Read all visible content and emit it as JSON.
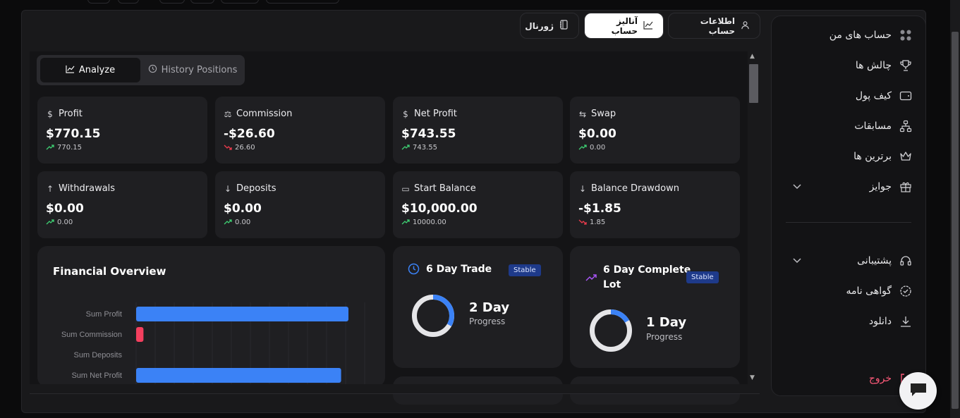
{
  "sidebar": {
    "items": [
      {
        "label": "حساب های من",
        "icon": "grid-icon"
      },
      {
        "label": "چالش ها",
        "icon": "trophy-icon"
      },
      {
        "label": "کیف پول",
        "icon": "wallet-icon"
      },
      {
        "label": "مسابقات",
        "icon": "network-icon"
      },
      {
        "label": "برترین ها",
        "icon": "crown-icon"
      },
      {
        "label": "جوایز",
        "icon": "gift-icon"
      },
      {
        "label": "پشتیبانی",
        "icon": "headset-icon"
      },
      {
        "label": "گواهی نامه",
        "icon": "certificate-icon"
      },
      {
        "label": "دانلود",
        "icon": "download-icon"
      }
    ],
    "logout": "خروج"
  },
  "top_tabs": [
    {
      "label": "اطلاعات حساب",
      "icon": "user-icon"
    },
    {
      "label": "آنالیز حساب",
      "icon": "chart-icon"
    },
    {
      "label": "ژورنال",
      "icon": "journal-icon"
    }
  ],
  "sub_tabs": {
    "analyze": "Analyze",
    "history": "History Positions"
  },
  "cards": [
    {
      "label": "Profit",
      "value": "$770.15",
      "sub": "770.15",
      "trend": "up",
      "icon": "dollar-icon"
    },
    {
      "label": "Commission",
      "value": "-$26.60",
      "sub": "26.60",
      "trend": "down",
      "icon": "scale-icon"
    },
    {
      "label": "Net Profit",
      "value": "$743.55",
      "sub": "743.55",
      "trend": "up",
      "icon": "dollar-icon"
    },
    {
      "label": "Swap",
      "value": "$0.00",
      "sub": "0.00",
      "trend": "up",
      "icon": "swap-icon"
    },
    {
      "label": "Withdrawals",
      "value": "$0.00",
      "sub": "0.00",
      "trend": "up",
      "icon": "arrow-up-icon"
    },
    {
      "label": "Deposits",
      "value": "$0.00",
      "sub": "0.00",
      "trend": "up",
      "icon": "arrow-down-icon"
    },
    {
      "label": "Start Balance",
      "value": "$10,000.00",
      "sub": "10000.00",
      "trend": "up",
      "icon": "wallet-icon"
    },
    {
      "label": "Balance Drawdown",
      "value": "-$1.85",
      "sub": "1.85",
      "trend": "down",
      "icon": "arrow-down-icon"
    }
  ],
  "financial_overview": {
    "title": "Financial Overview"
  },
  "chart_data": {
    "type": "bar",
    "orientation": "horizontal",
    "categories": [
      "Sum Profit",
      "Sum Commission",
      "Sum Deposits",
      "Sum Net Profit"
    ],
    "values": [
      770.15,
      26.6,
      0,
      743.55
    ],
    "colors": [
      "#3b82f6",
      "#f43f5e",
      "#3b82f6",
      "#3b82f6"
    ],
    "grid": true
  },
  "trade_days": {
    "title": "6 Day Trade",
    "badge": "Stable",
    "big": "2 Day",
    "small": "Progress",
    "progress": 0.333
  },
  "lot_days": {
    "title_line1": "6 Day Complete",
    "title_line2": "Lot",
    "badge": "Stable",
    "big": "1 Day",
    "small": "Progress",
    "progress": 0.167
  },
  "colors": {
    "accent_blue": "#3b82f6",
    "up": "#3ecf72",
    "down": "#ef3b4d",
    "logout": "#ff5a7a"
  }
}
